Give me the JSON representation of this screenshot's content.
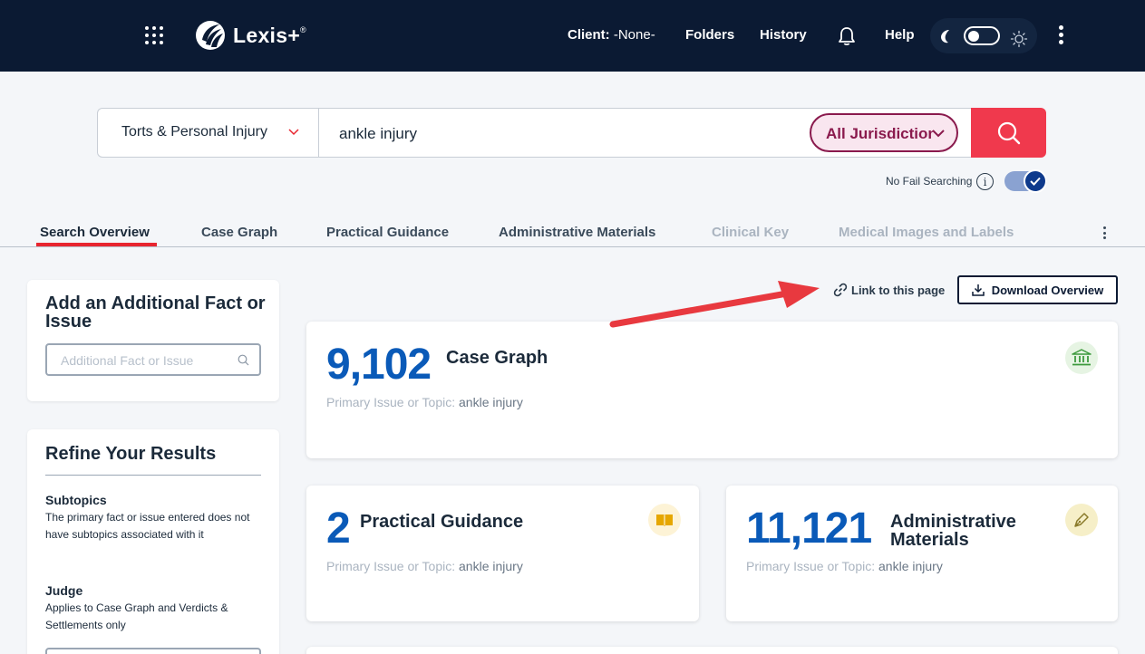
{
  "header": {
    "logo_text": "Lexis+",
    "logo_mark": "®",
    "client_label": "Client:",
    "client_value": "-None-",
    "nav": {
      "folders": "Folders",
      "history": "History",
      "help": "Help"
    }
  },
  "search": {
    "category": "Torts & Personal Injury",
    "query": "ankle injury",
    "jurisdiction": "All Jurisdictions",
    "no_fail_label": "No Fail Searching",
    "info_glyph": "i",
    "no_fail_enabled": true
  },
  "tabs": [
    {
      "label": "Search Overview",
      "state": "active"
    },
    {
      "label": "Case Graph",
      "state": "normal"
    },
    {
      "label": "Practical Guidance",
      "state": "normal"
    },
    {
      "label": "Administrative Materials",
      "state": "normal"
    },
    {
      "label": "Clinical Key",
      "state": "disabled"
    },
    {
      "label": "Medical Images and Labels",
      "state": "disabled"
    }
  ],
  "sidebar": {
    "fact_card_title": "Add an Additional Fact or Issue",
    "fact_placeholder": "Additional Fact or Issue",
    "refine_title": "Refine Your Results",
    "subtopics_title": "Subtopics",
    "subtopics_desc": "The primary fact or issue entered does not have subtopics associated with it",
    "judge_title": "Judge",
    "judge_desc": "Applies to Case Graph and Verdicts & Settlements only"
  },
  "actions": {
    "link_label": "Link to this page",
    "download_label": "Download Overview"
  },
  "results": [
    {
      "count": "9,102",
      "title": "Case Graph",
      "sub_label": "Primary Issue or Topic:",
      "sub_value": "ankle injury",
      "icon": "courthouse-icon",
      "icon_color": "#3d9a3d"
    },
    {
      "count": "2",
      "title": "Practical Guidance",
      "sub_label": "Primary Issue or Topic:",
      "sub_value": "ankle injury",
      "icon": "book-icon",
      "icon_color": "#e6a700"
    },
    {
      "count": "11,121",
      "title": "Administrative Materials",
      "sub_label": "Primary Issue or Topic:",
      "sub_value": "ankle injury",
      "icon": "pen-icon",
      "icon_color": "#8a7a2a"
    }
  ],
  "colors": {
    "nav_bg": "#0b1a33",
    "accent_red": "#f0394d",
    "jurisdiction": "#8a1a4d",
    "count_blue": "#0a5ab8",
    "annotation_arrow": "#e8393f"
  }
}
